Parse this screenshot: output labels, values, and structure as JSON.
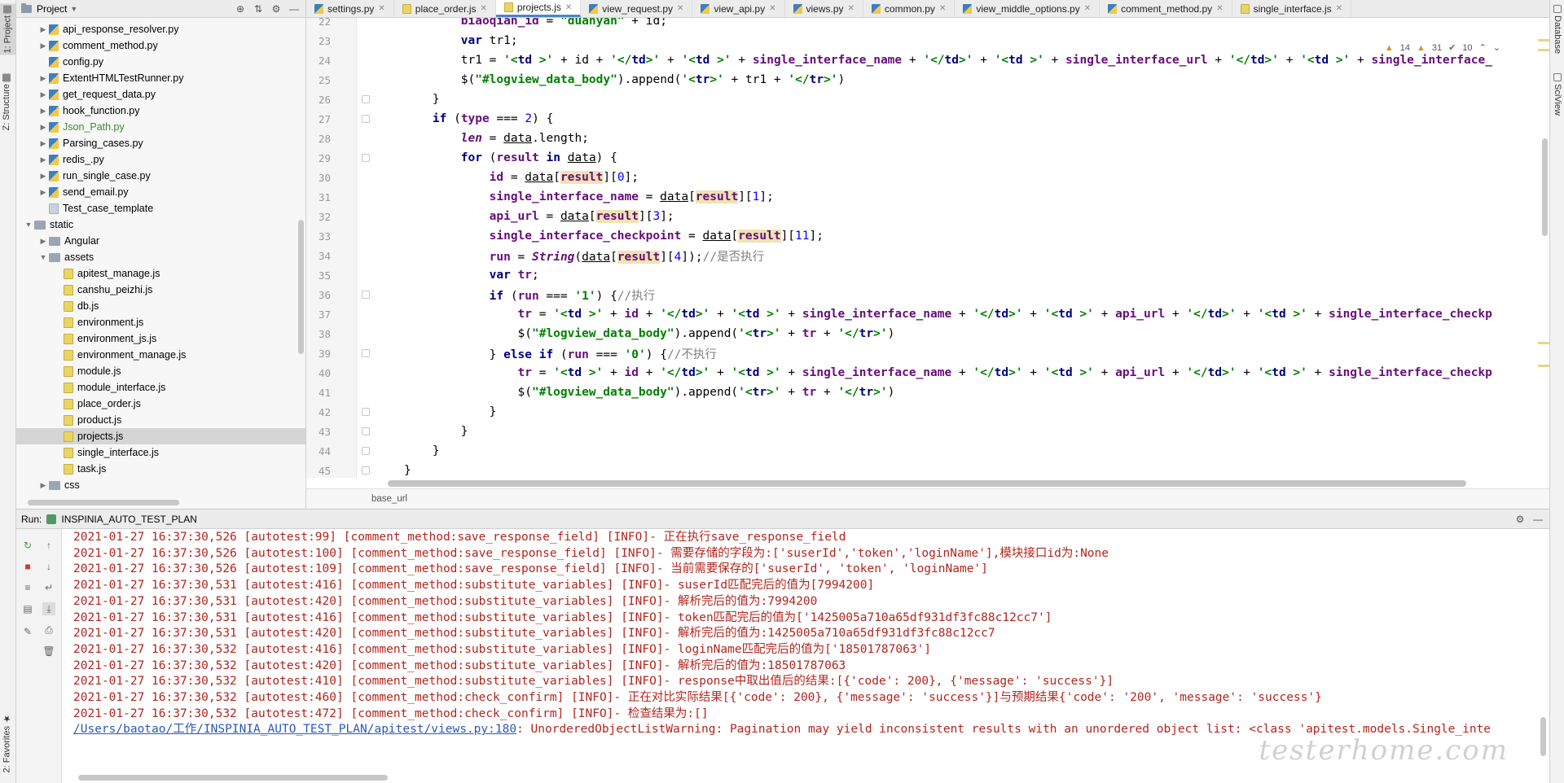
{
  "left_stripe": {
    "project_tab": "1: Project",
    "structure_tab": "Z: Structure",
    "favorites_tab": "2: Favorites"
  },
  "right_stripe": {
    "database_tab": "Database",
    "sciview_tab": "SciView"
  },
  "project_panel": {
    "title": "Project",
    "tree": [
      {
        "label": "api_response_resolver.py",
        "indent": 1,
        "arrow": "collapsed",
        "icon": "py"
      },
      {
        "label": "comment_method.py",
        "indent": 1,
        "arrow": "collapsed",
        "icon": "py"
      },
      {
        "label": "config.py",
        "indent": 1,
        "arrow": "none",
        "icon": "py"
      },
      {
        "label": "ExtentHTMLTestRunner.py",
        "indent": 1,
        "arrow": "collapsed",
        "icon": "py"
      },
      {
        "label": "get_request_data.py",
        "indent": 1,
        "arrow": "collapsed",
        "icon": "py"
      },
      {
        "label": "hook_function.py",
        "indent": 1,
        "arrow": "collapsed",
        "icon": "py"
      },
      {
        "label": "Json_Path.py",
        "indent": 1,
        "arrow": "collapsed",
        "icon": "py",
        "green": true
      },
      {
        "label": "Parsing_cases.py",
        "indent": 1,
        "arrow": "collapsed",
        "icon": "py"
      },
      {
        "label": "redis_.py",
        "indent": 1,
        "arrow": "collapsed",
        "icon": "py"
      },
      {
        "label": "run_single_case.py",
        "indent": 1,
        "arrow": "collapsed",
        "icon": "py"
      },
      {
        "label": "send_email.py",
        "indent": 1,
        "arrow": "collapsed",
        "icon": "py"
      },
      {
        "label": "Test_case_template",
        "indent": 1,
        "arrow": "none",
        "icon": "plain"
      },
      {
        "label": "static",
        "indent": 0,
        "arrow": "expanded",
        "icon": "dir"
      },
      {
        "label": "Angular",
        "indent": 1,
        "arrow": "collapsed",
        "icon": "dir"
      },
      {
        "label": "assets",
        "indent": 1,
        "arrow": "expanded",
        "icon": "dir"
      },
      {
        "label": "apitest_manage.js",
        "indent": 2,
        "arrow": "none",
        "icon": "js"
      },
      {
        "label": "canshu_peizhi.js",
        "indent": 2,
        "arrow": "none",
        "icon": "js"
      },
      {
        "label": "db.js",
        "indent": 2,
        "arrow": "none",
        "icon": "js"
      },
      {
        "label": "environment.js",
        "indent": 2,
        "arrow": "none",
        "icon": "js"
      },
      {
        "label": "environment_js.js",
        "indent": 2,
        "arrow": "none",
        "icon": "js"
      },
      {
        "label": "environment_manage.js",
        "indent": 2,
        "arrow": "none",
        "icon": "js"
      },
      {
        "label": "module.js",
        "indent": 2,
        "arrow": "none",
        "icon": "js"
      },
      {
        "label": "module_interface.js",
        "indent": 2,
        "arrow": "none",
        "icon": "js"
      },
      {
        "label": "place_order.js",
        "indent": 2,
        "arrow": "none",
        "icon": "js"
      },
      {
        "label": "product.js",
        "indent": 2,
        "arrow": "none",
        "icon": "js"
      },
      {
        "label": "projects.js",
        "indent": 2,
        "arrow": "none",
        "icon": "js",
        "selected": true
      },
      {
        "label": "single_interface.js",
        "indent": 2,
        "arrow": "none",
        "icon": "js"
      },
      {
        "label": "task.js",
        "indent": 2,
        "arrow": "none",
        "icon": "js"
      },
      {
        "label": "css",
        "indent": 1,
        "arrow": "collapsed",
        "icon": "dir"
      }
    ]
  },
  "editor": {
    "tabs": [
      {
        "label": "settings.py",
        "icon": "py",
        "active": false
      },
      {
        "label": "place_order.js",
        "icon": "js",
        "active": false
      },
      {
        "label": "projects.js",
        "icon": "js",
        "active": true
      },
      {
        "label": "view_request.py",
        "icon": "py",
        "active": false
      },
      {
        "label": "view_api.py",
        "icon": "py",
        "active": false
      },
      {
        "label": "views.py",
        "icon": "py",
        "active": false
      },
      {
        "label": "common.py",
        "icon": "py",
        "active": false
      },
      {
        "label": "view_middle_options.py",
        "icon": "py",
        "active": false
      },
      {
        "label": "comment_method.py",
        "icon": "py",
        "active": false
      },
      {
        "label": "single_interface.js",
        "icon": "js",
        "active": false
      }
    ],
    "inspections": {
      "warnings": "14",
      "weak_warnings": "31",
      "ok": "10"
    },
    "breadcrumb": "base_url",
    "lines": [
      {
        "num": "22",
        "indent": 16,
        "html": "<span class=\"var\">biaoqian_id</span> = <span class=\"str\">\"duanyan\"</span> + id;"
      },
      {
        "num": "23",
        "indent": 16,
        "html": "<span class=\"kw\">var</span> tr1;"
      },
      {
        "num": "24",
        "indent": 16,
        "html": "tr1 = <span class=\"str\">'&lt;</span><span class=\"tag\">td</span> <span class=\"str\">&gt;'</span> + id + <span class=\"str\">'&lt;/</span><span class=\"tag\">td</span><span class=\"str\">&gt;'</span> + <span class=\"str\">'&lt;</span><span class=\"tag\">td</span> <span class=\"str\">&gt;'</span> + <span class=\"var\">single_interface_name</span> + <span class=\"str\">'&lt;/</span><span class=\"tag\">td</span><span class=\"str\">&gt;'</span> + <span class=\"str\">'&lt;</span><span class=\"tag\">td</span> <span class=\"str\">&gt;'</span> + <span class=\"var\">single_interface_url</span> + <span class=\"str\">'&lt;/</span><span class=\"tag\">td</span><span class=\"str\">&gt;'</span> + <span class=\"str\">'&lt;</span><span class=\"tag\">td</span> <span class=\"str\">&gt;'</span> + <span class=\"var\">single_interface_</span>"
      },
      {
        "num": "25",
        "indent": 16,
        "html": "$(<span class=\"str\">\"#logview_data_body\"</span>).append(<span class=\"str\">'&lt;</span><span class=\"tag\">tr</span><span class=\"str\">&gt;'</span> + tr1 + <span class=\"str\">'&lt;/</span><span class=\"tag\">tr</span><span class=\"str\">&gt;'</span>)"
      },
      {
        "num": "26",
        "indent": 12,
        "html": "}"
      },
      {
        "num": "27",
        "indent": 12,
        "html": "<span class=\"kw\">if</span> (<span class=\"var\">type</span> === <span class=\"num\">2</span>) {"
      },
      {
        "num": "28",
        "indent": 16,
        "html": "<span class=\"var\" style=\"font-style:italic\">len</span> = <span class=\"ul\">data</span>.length;"
      },
      {
        "num": "29",
        "indent": 16,
        "html": "<span class=\"kw\">for</span> (<span class=\"var\">result</span> <span class=\"kw\">in</span> <span class=\"ul\">data</span>) {"
      },
      {
        "num": "30",
        "indent": 20,
        "html": "<span class=\"var\">id</span> = <span class=\"ul\">data</span>[<span class=\"var hl\">result</span>][<span class=\"num\">0</span>];"
      },
      {
        "num": "31",
        "indent": 20,
        "html": "<span class=\"var\">single_interface_name</span> = <span class=\"ul\">data</span>[<span class=\"var hl\">result</span>][<span class=\"num\">1</span>];"
      },
      {
        "num": "32",
        "indent": 20,
        "html": "<span class=\"var\">api_url</span> = <span class=\"ul\">data</span>[<span class=\"var hl\">result</span>][<span class=\"num\">3</span>];"
      },
      {
        "num": "33",
        "indent": 20,
        "html": "<span class=\"var\">single_interface_checkpoint</span> = <span class=\"ul\">data</span>[<span class=\"var hl\">result</span>][<span class=\"num\">11</span>];"
      },
      {
        "num": "34",
        "indent": 20,
        "html": "<span class=\"var\">run</span> = <span class=\"fn\">String</span>(<span class=\"ul\">data</span>[<span class=\"var hl\">result</span>][<span class=\"num\">4</span>]);<span class=\"cmt\">//是否执行</span>"
      },
      {
        "num": "35",
        "indent": 20,
        "html": "<span class=\"kw\">var</span> <span class=\"var\">tr</span>;"
      },
      {
        "num": "36",
        "indent": 20,
        "html": "<span class=\"kw\">if</span> (<span class=\"var\">run</span> === <span class=\"str\">'1'</span>) {<span class=\"cmt\">//执行</span>"
      },
      {
        "num": "37",
        "indent": 24,
        "html": "<span class=\"var\">tr</span> = <span class=\"str\">'&lt;</span><span class=\"tag\">td</span> <span class=\"str\">&gt;'</span> + <span class=\"var\">id</span> + <span class=\"str\">'&lt;/</span><span class=\"tag\">td</span><span class=\"str\">&gt;'</span> + <span class=\"str\">'&lt;</span><span class=\"tag\">td</span> <span class=\"str\">&gt;'</span> + <span class=\"var\">single_interface_name</span> + <span class=\"str\">'&lt;/</span><span class=\"tag\">td</span><span class=\"str\">&gt;'</span> + <span class=\"str\">'&lt;</span><span class=\"tag\">td</span> <span class=\"str\">&gt;'</span> + <span class=\"var\">api_url</span> + <span class=\"str\">'&lt;/</span><span class=\"tag\">td</span><span class=\"str\">&gt;'</span> + <span class=\"str\">'&lt;</span><span class=\"tag\">td</span> <span class=\"str\">&gt;'</span> + <span class=\"var\">single_interface_checkp</span>"
      },
      {
        "num": "38",
        "indent": 24,
        "html": "$(<span class=\"str\">\"#logview_data_body\"</span>).append(<span class=\"str\">'&lt;</span><span class=\"tag\">tr</span><span class=\"str\">&gt;'</span> + <span class=\"var\">tr</span> + <span class=\"str\">'&lt;/</span><span class=\"tag\">tr</span><span class=\"str\">&gt;'</span>)"
      },
      {
        "num": "39",
        "indent": 20,
        "html": "} <span class=\"kw\">else if</span> (<span class=\"var\">run</span> === <span class=\"str\">'0'</span>) {<span class=\"cmt\">//不执行</span>"
      },
      {
        "num": "40",
        "indent": 24,
        "html": "<span class=\"var\">tr</span> = <span class=\"str\">'&lt;</span><span class=\"tag\">td</span> <span class=\"str\">&gt;'</span> + <span class=\"var\">id</span> + <span class=\"str\">'&lt;/</span><span class=\"tag\">td</span><span class=\"str\">&gt;'</span> + <span class=\"str\">'&lt;</span><span class=\"tag\">td</span> <span class=\"str\">&gt;'</span> + <span class=\"var\">single_interface_name</span> + <span class=\"str\">'&lt;/</span><span class=\"tag\">td</span><span class=\"str\">&gt;'</span> + <span class=\"str\">'&lt;</span><span class=\"tag\">td</span> <span class=\"str\">&gt;'</span> + <span class=\"var\">api_url</span> + <span class=\"str\">'&lt;/</span><span class=\"tag\">td</span><span class=\"str\">&gt;'</span> + <span class=\"str\">'&lt;</span><span class=\"tag\">td</span> <span class=\"str\">&gt;'</span> + <span class=\"var\">single_interface_checkp</span>"
      },
      {
        "num": "41",
        "indent": 24,
        "html": "$(<span class=\"str\">\"#logview_data_body\"</span>).append(<span class=\"str\">'&lt;</span><span class=\"tag\">tr</span><span class=\"str\">&gt;'</span> + <span class=\"var\">tr</span> + <span class=\"str\">'&lt;/</span><span class=\"tag\">tr</span><span class=\"str\">&gt;'</span>)"
      },
      {
        "num": "42",
        "indent": 20,
        "html": "}"
      },
      {
        "num": "43",
        "indent": 16,
        "html": "}"
      },
      {
        "num": "44",
        "indent": 12,
        "html": "}"
      },
      {
        "num": "45",
        "indent": 8,
        "html": "}"
      }
    ]
  },
  "run_panel": {
    "label": "Run:",
    "config_name": "INSPINIA_AUTO_TEST_PLAN",
    "lines": [
      {
        "text": "2021-01-27 16:37:30,526 [autotest:99] [comment_method:save_response_field] [INFO]- 正在执行save_response_field"
      },
      {
        "text": "2021-01-27 16:37:30,526 [autotest:100] [comment_method:save_response_field] [INFO]- 需要存储的字段为:['suserId','token','loginName'],模块接口id为:None"
      },
      {
        "text": "2021-01-27 16:37:30,526 [autotest:109] [comment_method:save_response_field] [INFO]- 当前需要保存的['suserId', 'token', 'loginName']"
      },
      {
        "text": "2021-01-27 16:37:30,531 [autotest:416] [comment_method:substitute_variables] [INFO]- suserId匹配完后的值为[7994200]"
      },
      {
        "text": "2021-01-27 16:37:30,531 [autotest:420] [comment_method:substitute_variables] [INFO]- 解析完后的值为:7994200"
      },
      {
        "text": "2021-01-27 16:37:30,531 [autotest:416] [comment_method:substitute_variables] [INFO]- token匹配完后的值为['1425005a710a65df931df3fc88c12cc7']"
      },
      {
        "text": "2021-01-27 16:37:30,531 [autotest:420] [comment_method:substitute_variables] [INFO]- 解析完后的值为:1425005a710a65df931df3fc88c12cc7"
      },
      {
        "text": "2021-01-27 16:37:30,532 [autotest:416] [comment_method:substitute_variables] [INFO]- loginName匹配完后的值为['18501787063']"
      },
      {
        "text": "2021-01-27 16:37:30,532 [autotest:420] [comment_method:substitute_variables] [INFO]- 解析完后的值为:18501787063"
      },
      {
        "text": "2021-01-27 16:37:30,532 [autotest:410] [comment_method:substitute_variables] [INFO]- response中取出值后的结果:[{'code': 200}, {'message': 'success'}]"
      },
      {
        "text": "2021-01-27 16:37:30,532 [autotest:460] [comment_method:check_confirm] [INFO]- 正在对比实际结果[{'code': 200}, {'message': 'success'}]与预期结果{'code': '200', 'message': 'success'}"
      },
      {
        "text": "2021-01-27 16:37:30,532 [autotest:472] [comment_method:check_confirm] [INFO]- 检查结果为:[]"
      }
    ],
    "last_line_link": "/Users/baotao/工作/INSPINIA_AUTO_TEST_PLAN/apitest/views.py:180",
    "last_line_rest": ": UnorderedObjectListWarning: Pagination may yield inconsistent results with an unordered object list: <class 'apitest.models.Single_inte",
    "watermark": "testerhome.com"
  }
}
